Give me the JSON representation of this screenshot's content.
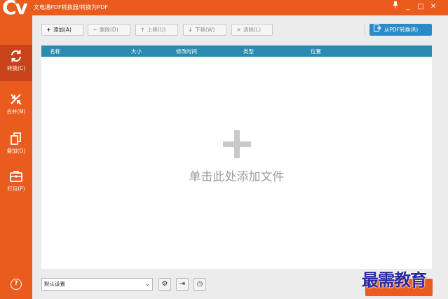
{
  "window": {
    "logo_text": "Cv",
    "title": "文电通PDF转换器/转换为PDF",
    "controls": {
      "pin": "📌",
      "minimize": "_",
      "maximize": "□",
      "close": "✕"
    }
  },
  "sidebar": {
    "items": [
      {
        "label": "转换(C)",
        "icon": "convert-icon",
        "active": true
      },
      {
        "label": "合并(M)",
        "icon": "merge-icon",
        "active": false
      },
      {
        "label": "叠加(O)",
        "icon": "overlay-icon",
        "active": false
      },
      {
        "label": "打包(P)",
        "icon": "package-icon",
        "active": false
      }
    ],
    "help": "?"
  },
  "toolbar": {
    "add": {
      "icon": "+",
      "label": "添加(A)"
    },
    "delete": {
      "icon": "−",
      "label": "删除(D)"
    },
    "move_up": {
      "icon": "↑",
      "label": "上移(U)"
    },
    "move_down": {
      "icon": "↓",
      "label": "下移(W)"
    },
    "clear": {
      "icon": "✕",
      "label": "清除(L)"
    },
    "from_pdf": {
      "label": "从PDF转换(R)"
    }
  },
  "table": {
    "columns": [
      "名称",
      "大小",
      "修改时间",
      "类型",
      "位置"
    ],
    "rows": [],
    "empty_hint": "单击此处添加文件"
  },
  "bottom": {
    "preset": "默认设置",
    "settings_icon": "⚙",
    "export_icon": "⇥",
    "history_icon": "◷"
  },
  "watermark": "最需教育",
  "colors": {
    "brand": "#e95c1d",
    "header": "#2a8ab0",
    "accent": "#2b8bc8"
  }
}
